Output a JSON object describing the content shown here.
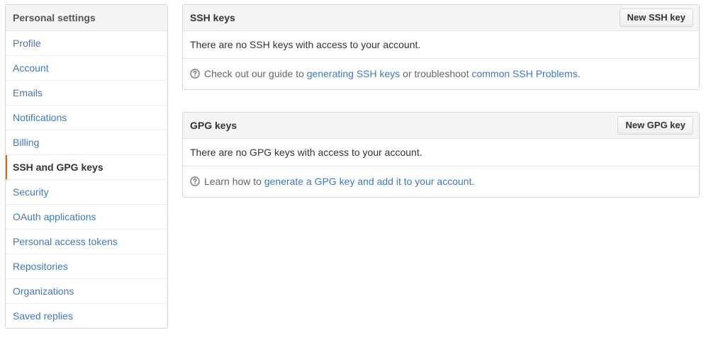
{
  "sidebar": {
    "title": "Personal settings",
    "items": [
      {
        "label": "Profile"
      },
      {
        "label": "Account"
      },
      {
        "label": "Emails"
      },
      {
        "label": "Notifications"
      },
      {
        "label": "Billing"
      },
      {
        "label": "SSH and GPG keys",
        "selected": true
      },
      {
        "label": "Security"
      },
      {
        "label": "OAuth applications"
      },
      {
        "label": "Personal access tokens"
      },
      {
        "label": "Repositories"
      },
      {
        "label": "Organizations"
      },
      {
        "label": "Saved replies"
      }
    ],
    "selected_accent": "#d26911"
  },
  "ssh": {
    "title": "SSH keys",
    "button": "New SSH key",
    "empty_text": "There are no SSH keys with access to your account.",
    "help": {
      "icon": "question-circle-icon",
      "prefix": "Check out our guide to ",
      "link1": "generating SSH keys",
      "middle": " or troubleshoot ",
      "link2": "common SSH Problems",
      "suffix": "."
    }
  },
  "gpg": {
    "title": "GPG keys",
    "button": "New GPG key",
    "empty_text": "There are no GPG keys with access to your account.",
    "help": {
      "icon": "question-circle-icon",
      "prefix": "Learn how to ",
      "link1": "generate a GPG key and add it to your account",
      "suffix": "."
    }
  },
  "colors": {
    "link": "#4078c0",
    "header_bg": "#f5f5f5",
    "border": "#d1d5da"
  }
}
